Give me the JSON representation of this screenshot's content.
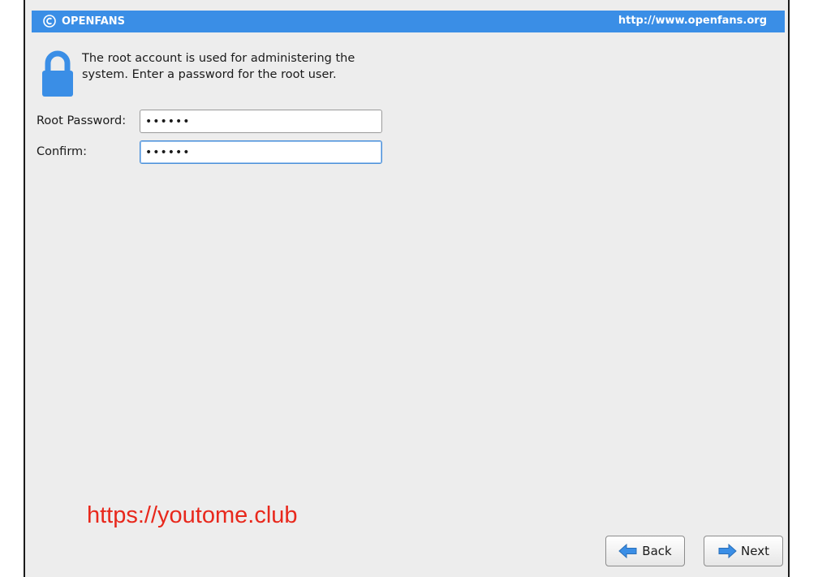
{
  "banner": {
    "brand": "OPENFANS",
    "url": "http://www.openfans.org"
  },
  "intro": {
    "text": "The root account is used for administering the system.  Enter a password for the root user."
  },
  "form": {
    "root_password_label": "Root Password:",
    "root_password_value": "••••••",
    "confirm_label": "Confirm:",
    "confirm_value": "••••••"
  },
  "watermark": "https://youtome.club",
  "buttons": {
    "back_label": "Back",
    "next_label": "Next"
  },
  "colors": {
    "banner": "#3a8ee6",
    "lock": "#3a8ee6",
    "watermark": "#e8281c"
  },
  "icons": {
    "brand": "openfans-logo-icon",
    "lock": "padlock-icon",
    "back": "arrow-left-icon",
    "next": "arrow-right-icon"
  }
}
